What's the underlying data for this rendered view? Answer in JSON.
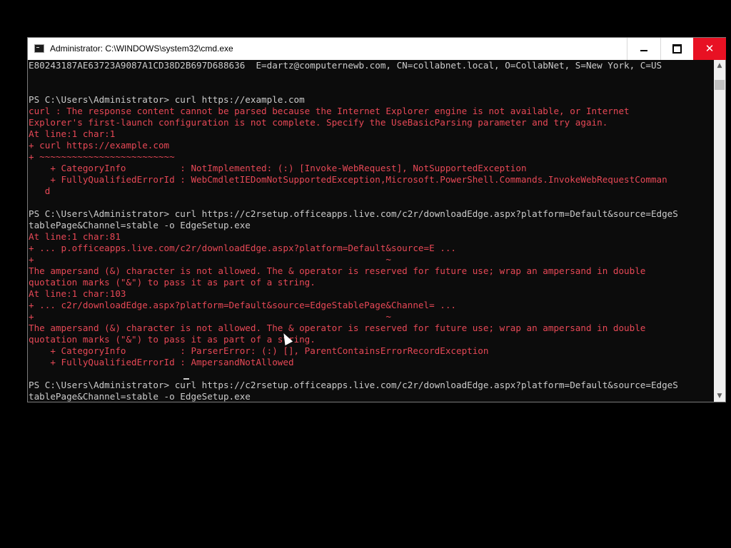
{
  "window": {
    "title": "Administrator: C:\\WINDOWS\\system32\\cmd.exe",
    "minimize_label": "minimize",
    "maximize_label": "maximize",
    "close_label": "close"
  },
  "console": {
    "lines": [
      {
        "text": "E80243187AE63723A9087A1CD38D2B697D688636  E=dartz@computernewb.com, CN=collabnet.local, O=CollabNet, S=New York, C=US",
        "color": "w"
      },
      {
        "text": "",
        "color": "w"
      },
      {
        "text": "",
        "color": "w"
      },
      {
        "text": "PS C:\\Users\\Administrator> curl https://example.com",
        "color": "w"
      },
      {
        "text": "curl : The response content cannot be parsed because the Internet Explorer engine is not available, or Internet",
        "color": "r"
      },
      {
        "text": "Explorer's first-launch configuration is not complete. Specify the UseBasicParsing parameter and try again.",
        "color": "r"
      },
      {
        "text": "At line:1 char:1",
        "color": "r"
      },
      {
        "text": "+ curl https://example.com",
        "color": "r"
      },
      {
        "text": "+ ~~~~~~~~~~~~~~~~~~~~~~~~~",
        "color": "r"
      },
      {
        "text": "    + CategoryInfo          : NotImplemented: (:) [Invoke-WebRequest], NotSupportedException",
        "color": "r"
      },
      {
        "text": "    + FullyQualifiedErrorId : WebCmdletIEDomNotSupportedException,Microsoft.PowerShell.Commands.InvokeWebRequestComman",
        "color": "r"
      },
      {
        "text": "   d",
        "color": "r"
      },
      {
        "text": "",
        "color": "w"
      },
      {
        "text": "PS C:\\Users\\Administrator> curl https://c2rsetup.officeapps.live.com/c2r/downloadEdge.aspx?platform=Default&source=EdgeS",
        "color": "w"
      },
      {
        "text": "tablePage&Channel=stable -o EdgeSetup.exe",
        "color": "w"
      },
      {
        "text": "At line:1 char:81",
        "color": "r"
      },
      {
        "text": "+ ... p.officeapps.live.com/c2r/downloadEdge.aspx?platform=Default&source=E ...",
        "color": "r"
      },
      {
        "text": "+                                                                 ~",
        "color": "r"
      },
      {
        "text": "The ampersand (&) character is not allowed. The & operator is reserved for future use; wrap an ampersand in double",
        "color": "r"
      },
      {
        "text": "quotation marks (\"&\") to pass it as part of a string.",
        "color": "r"
      },
      {
        "text": "At line:1 char:103",
        "color": "r"
      },
      {
        "text": "+ ... c2r/downloadEdge.aspx?platform=Default&source=EdgeStablePage&Channel= ...",
        "color": "r"
      },
      {
        "text": "+                                                                 ~",
        "color": "r"
      },
      {
        "text": "The ampersand (&) character is not allowed. The & operator is reserved for future use; wrap an ampersand in double",
        "color": "r"
      },
      {
        "text": "quotation marks (\"&\") to pass it as part of a string.",
        "color": "r"
      },
      {
        "text": "    + CategoryInfo          : ParserError: (:) [], ParentContainsErrorRecordException",
        "color": "r"
      },
      {
        "text": "    + FullyQualifiedErrorId : AmpersandNotAllowed",
        "color": "r"
      },
      {
        "text": "",
        "color": "w"
      },
      {
        "text": "PS C:\\Users\\Administrator> curl https://c2rsetup.officeapps.live.com/c2r/downloadEdge.aspx?platform=Default&source=EdgeS",
        "color": "w"
      },
      {
        "text": "tablePage&Channel=stable -o EdgeSetup.exe",
        "color": "w"
      }
    ]
  },
  "scrollbar": {
    "up_arrow_icon": "chevron-up-icon",
    "down_arrow_icon": "chevron-down-icon"
  },
  "colors": {
    "console_bg": "#0c0c0c",
    "console_text": "#cccccc",
    "error_text": "#e74856",
    "close_button": "#e81123"
  }
}
